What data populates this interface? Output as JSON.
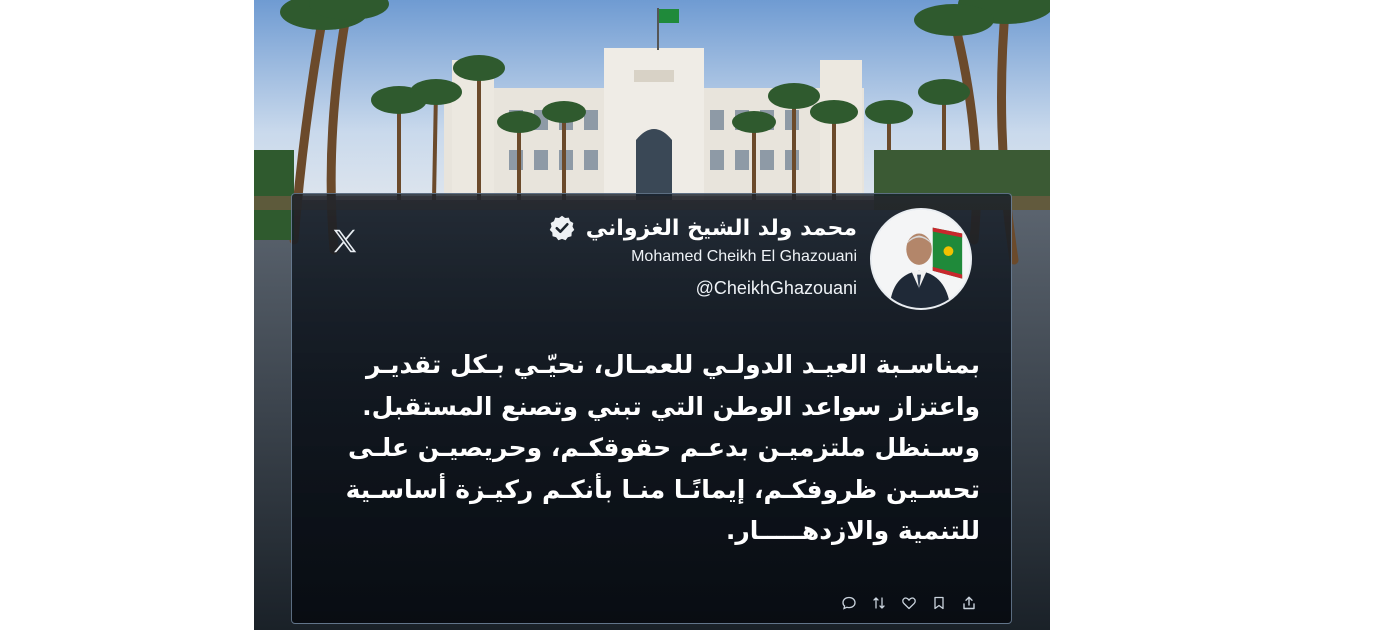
{
  "tweet": {
    "author_name_ar": "محمد ولد الشيخ الغزواني",
    "author_name_en": "Mohamed Cheikh El Ghazouani",
    "handle": "@CheikhGhazouani",
    "verified": true,
    "body_lines": [
      "بمناسـبة العيـد الدولـي للعمـال، نحيّـي بـكل تقديـر",
      "واعتزاز سواعد الوطن التي تبني وتصنع المستقبل.",
      "وسـنظل ملتزميـن بدعـم حقوقكـم، وحريصيـن علـى",
      "تحسـين ظروفكـم، إيمانًـا منـا بأنكـم ركيـزة أساسـية",
      "للتنمية والازدهـــــار."
    ],
    "actions": [
      "reply-icon",
      "repost-icon",
      "like-icon",
      "bookmark-icon",
      "share-icon"
    ]
  },
  "platform_icon": "x-logo-icon",
  "colors": {
    "card_border": "#9fbedc",
    "text": "#ffffff",
    "flag_green": "#1f8a3a",
    "flag_red": "#c8282d",
    "flag_gold": "#f2c100"
  }
}
